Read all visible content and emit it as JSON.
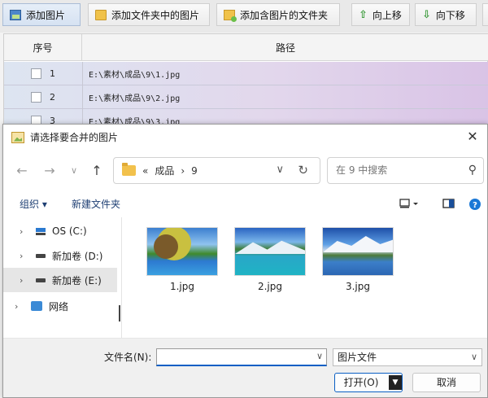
{
  "toolbar": {
    "add_image": "添加图片",
    "add_folder_images": "添加文件夹中的图片",
    "add_folders_with_images": "添加含图片的文件夹",
    "move_up": "向上移",
    "move_down": "向下移"
  },
  "grid": {
    "headers": {
      "index": "序号",
      "path": "路径"
    },
    "rows": [
      {
        "num": "1",
        "path": "E:\\素材\\成品\\9\\1.jpg"
      },
      {
        "num": "2",
        "path": "E:\\素材\\成品\\9\\2.jpg"
      },
      {
        "num": "3",
        "path": "E:\\素材\\成品\\9\\3.jpg"
      }
    ]
  },
  "dialog": {
    "title": "请选择要合并的图片",
    "address": {
      "prefix": "«",
      "crumb1": "成品",
      "sep": "›",
      "crumb2": "9"
    },
    "search_placeholder": "在 9 中搜索",
    "organize": "组织 ▾",
    "new_folder": "新建文件夹",
    "nav": [
      {
        "label": "OS (C:)"
      },
      {
        "label": "新加卷 (D:)"
      },
      {
        "label": "新加卷 (E:)"
      },
      {
        "label": "网络"
      }
    ],
    "files": [
      {
        "name": "1.jpg"
      },
      {
        "name": "2.jpg"
      },
      {
        "name": "3.jpg"
      }
    ],
    "filename_label": "文件名(N):",
    "filename_value": "",
    "filetype": "图片文件",
    "open_label": "打开(O)",
    "cancel_label": "取消"
  }
}
